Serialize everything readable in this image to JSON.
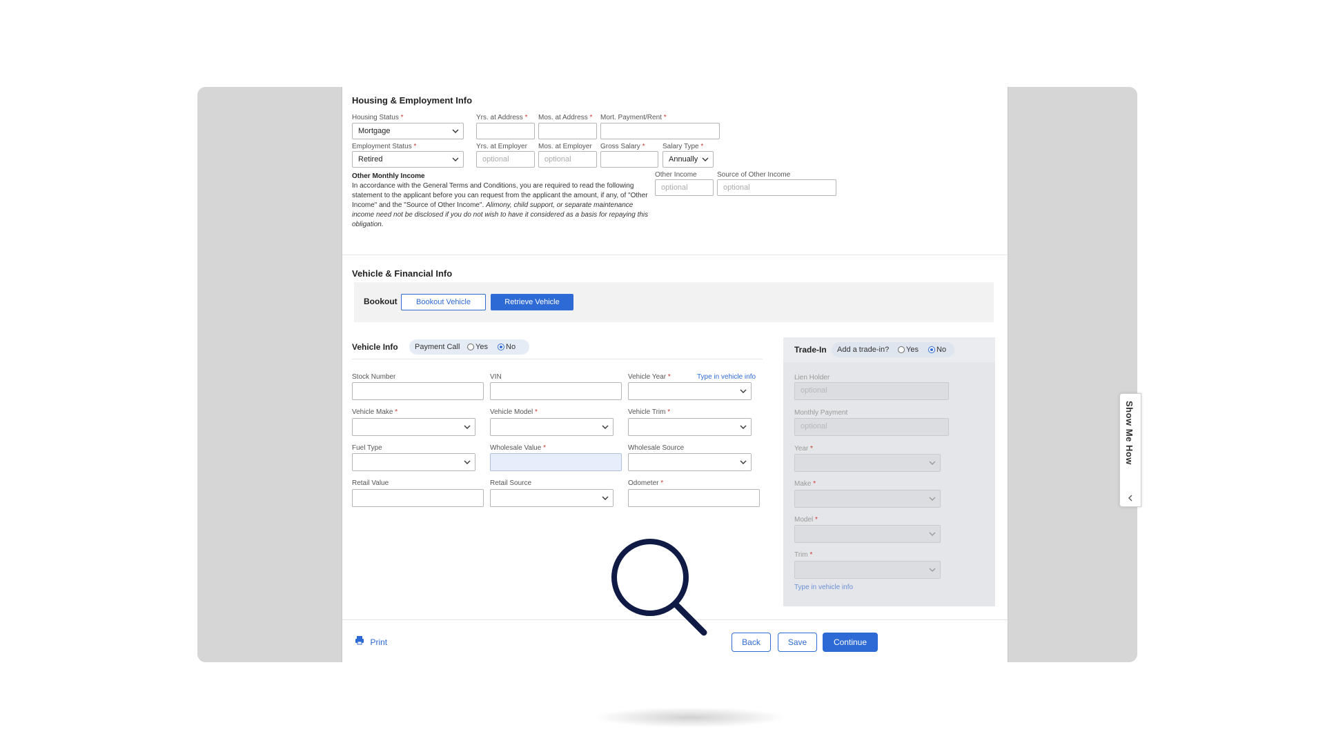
{
  "housing": {
    "title": "Housing & Employment Info",
    "housing_status": {
      "label": "Housing Status",
      "value": "Mortgage"
    },
    "yrs_address": {
      "label": "Yrs. at Address"
    },
    "mos_address": {
      "label": "Mos. at Address"
    },
    "mort_payment": {
      "label": "Mort. Payment/Rent"
    },
    "employment_status": {
      "label": "Employment Status",
      "value": "Retired"
    },
    "yrs_employer": {
      "label": "Yrs. at Employer",
      "placeholder": "optional"
    },
    "mos_employer": {
      "label": "Mos. at Employer",
      "placeholder": "optional"
    },
    "gross_salary": {
      "label": "Gross Salary"
    },
    "salary_type": {
      "label": "Salary Type",
      "value": "Annually"
    },
    "other_income_title": "Other Monthly Income",
    "other_income_text": "In accordance with the General Terms and Conditions, you are required to read the following statement to the applicant before you can request from the applicant the amount, if any, of \"Other Income\" and the \"Source of Other Income\".",
    "other_income_italic": "Alimony, child support, or separate maintenance income need not be disclosed if you do not wish to have it considered as a basis for repaying this obligation.",
    "other_income": {
      "label": "Other Income",
      "placeholder": "optional"
    },
    "source_other_income": {
      "label": "Source of Other Income",
      "placeholder": "optional"
    }
  },
  "vehicle_financial": {
    "title": "Vehicle & Financial Info",
    "bookout_label": "Bookout",
    "bookout_button": "Bookout Vehicle",
    "retrieve_button": "Retrieve Vehicle"
  },
  "vehicle_info": {
    "title": "Vehicle Info",
    "payment_call": "Payment Call",
    "yes": "Yes",
    "no": "No",
    "selected": "No",
    "type_in_link": "Type in vehicle info",
    "fields": {
      "stock_number": "Stock Number",
      "vin": "VIN",
      "vehicle_year": "Vehicle Year",
      "vehicle_make": "Vehicle Make",
      "vehicle_model": "Vehicle Model",
      "vehicle_trim": "Vehicle Trim",
      "fuel_type": "Fuel Type",
      "wholesale_value": "Wholesale Value",
      "wholesale_source": "Wholesale Source",
      "retail_value": "Retail Value",
      "retail_source": "Retail Source",
      "odometer": "Odometer"
    }
  },
  "trade_in": {
    "title": "Trade-In",
    "question": "Add a trade-in?",
    "yes": "Yes",
    "no": "No",
    "selected": "No",
    "lien_holder": {
      "label": "Lien Holder",
      "placeholder": "optional"
    },
    "monthly_payment": {
      "label": "Monthly Payment",
      "placeholder": "optional"
    },
    "year": "Year",
    "make": "Make",
    "model": "Model",
    "trim": "Trim",
    "type_in_link": "Type in vehicle info"
  },
  "footer": {
    "print": "Print",
    "back": "Back",
    "save": "Save",
    "continue": "Continue"
  },
  "side_tab": {
    "label": "Show Me How"
  },
  "colors": {
    "accent": "#2e6ad6",
    "required": "#d0342c"
  }
}
